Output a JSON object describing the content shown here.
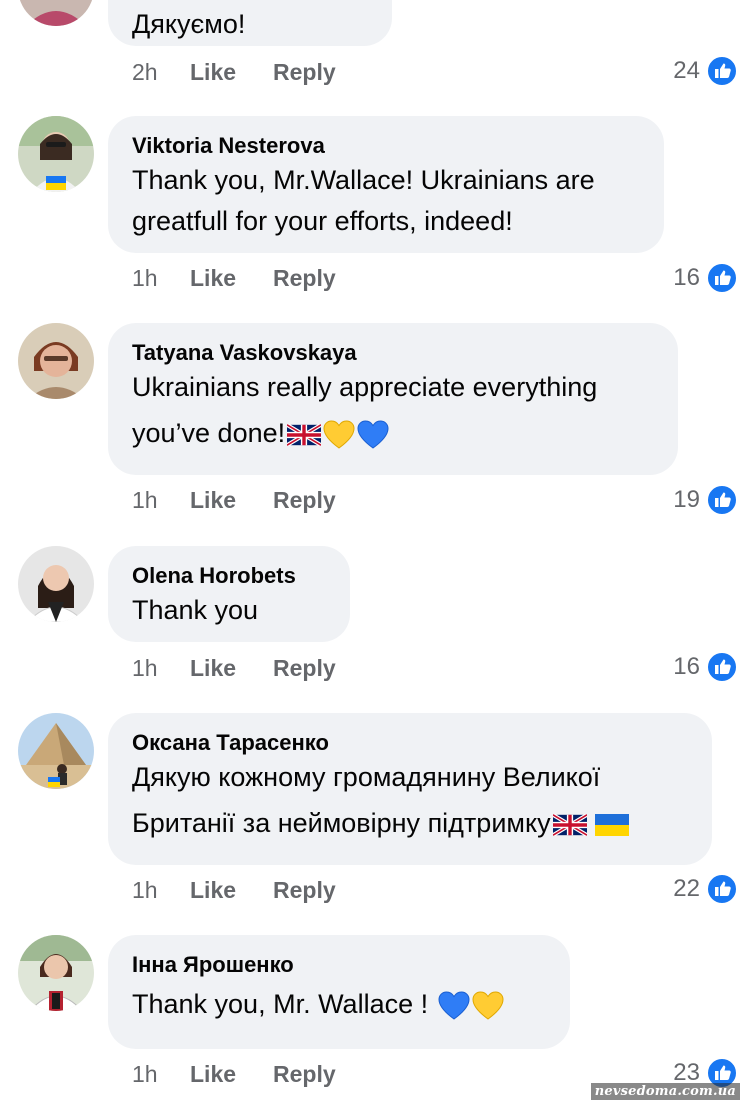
{
  "comments": [
    {
      "author": "",
      "lines": [
        "Дякуємо!"
      ],
      "time": "2h",
      "like_label": "Like",
      "reply_label": "Reply",
      "reaction_count": "24"
    },
    {
      "author": "Viktoria  Nesterova",
      "lines": [
        "Thank you, Mr.Wallace! Ukrainians are",
        "greatfull for your efforts, indeed!"
      ],
      "time": "1h",
      "like_label": "Like",
      "reply_label": "Reply",
      "reaction_count": "16"
    },
    {
      "author": "Tatyana Vaskovskaya",
      "lines": [
        "Ukrainians really appreciate everything",
        "you’ve done!"
      ],
      "emojis": [
        "uk-flag-emoji",
        "yellow-heart-emoji",
        "blue-heart-emoji"
      ],
      "time": "1h",
      "like_label": "Like",
      "reply_label": "Reply",
      "reaction_count": "19"
    },
    {
      "author": "Olena Horobets",
      "lines": [
        "Thank you"
      ],
      "time": "1h",
      "like_label": "Like",
      "reply_label": "Reply",
      "reaction_count": "16"
    },
    {
      "author": "Оксана Тарасенко",
      "lines": [
        "Дякую кожному громадянину Великої",
        "Британії за неймовірну підтримку"
      ],
      "emojis": [
        "uk-flag-emoji",
        "ukraine-flag-emoji"
      ],
      "time": "1h",
      "like_label": "Like",
      "reply_label": "Reply",
      "reaction_count": "22"
    },
    {
      "author": "Інна Ярошенко",
      "lines": [
        "Thank you, Mr. Wallace ! "
      ],
      "emojis": [
        "blue-heart-emoji",
        "yellow-heart-emoji"
      ],
      "time": "1h",
      "like_label": "Like",
      "reply_label": "Reply",
      "reaction_count": "23"
    }
  ],
  "reaction_icon": "like-thumb-icon",
  "colors": {
    "bubble": "#f0f2f5",
    "meta_text": "#65676b",
    "like_blue": "#1877f2"
  },
  "watermark": "nevsedoma.com.ua"
}
